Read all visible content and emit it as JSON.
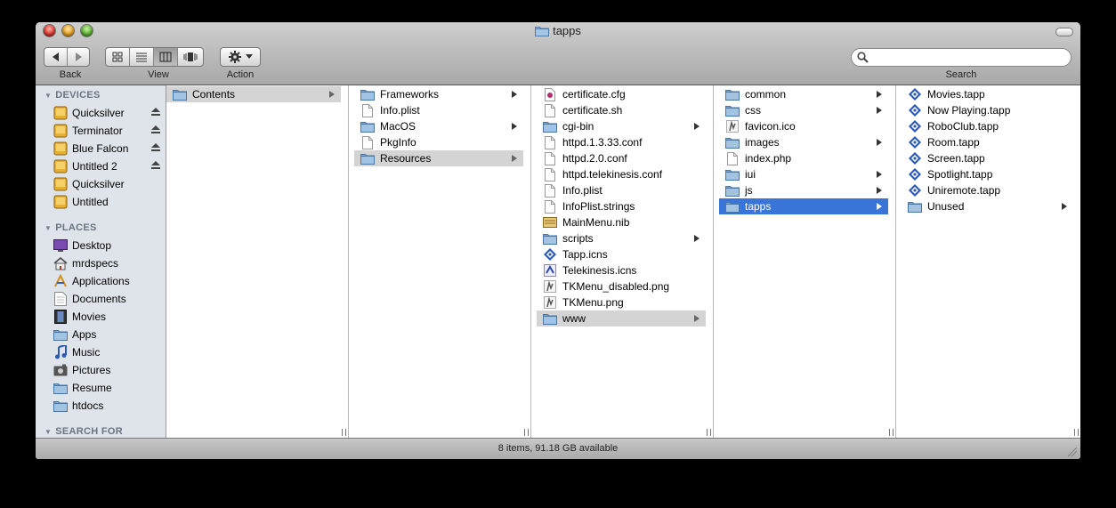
{
  "window": {
    "title": "tapps",
    "status": "8 items, 91.18 GB available"
  },
  "toolbar": {
    "back_label": "Back",
    "view_label": "View",
    "action_label": "Action",
    "search_label": "Search",
    "search_placeholder": ""
  },
  "sidebar": {
    "devices_header": "DEVICES",
    "devices": [
      {
        "label": "Quicksilver",
        "icon": "hd-icon",
        "eject": true
      },
      {
        "label": "Terminator",
        "icon": "hd-icon",
        "eject": true
      },
      {
        "label": "Blue Falcon",
        "icon": "hd-icon",
        "eject": true
      },
      {
        "label": "Untitled 2",
        "icon": "hd-icon",
        "eject": true
      },
      {
        "label": "Quicksilver",
        "icon": "hd-icon",
        "eject": false
      },
      {
        "label": "Untitled",
        "icon": "hd-icon",
        "eject": false
      }
    ],
    "places_header": "PLACES",
    "places": [
      {
        "label": "Desktop",
        "icon": "desktop-icon"
      },
      {
        "label": "mrdspecs",
        "icon": "home-icon"
      },
      {
        "label": "Applications",
        "icon": "applications-icon"
      },
      {
        "label": "Documents",
        "icon": "documents-icon"
      },
      {
        "label": "Movies",
        "icon": "movies-icon"
      },
      {
        "label": "Apps",
        "icon": "folder-icon"
      },
      {
        "label": "Music",
        "icon": "music-icon"
      },
      {
        "label": "Pictures",
        "icon": "pictures-icon"
      },
      {
        "label": "Resume",
        "icon": "folder-icon"
      },
      {
        "label": "htdocs",
        "icon": "folder-icon"
      }
    ],
    "search_header": "SEARCH FOR"
  },
  "columns": [
    {
      "items": [
        {
          "label": "Contents",
          "type": "folder",
          "arrow": true,
          "selected": "gray"
        }
      ]
    },
    {
      "items": [
        {
          "label": "Frameworks",
          "type": "folder",
          "arrow": true
        },
        {
          "label": "Info.plist",
          "type": "file"
        },
        {
          "label": "MacOS",
          "type": "folder",
          "arrow": true
        },
        {
          "label": "PkgInfo",
          "type": "file"
        },
        {
          "label": "Resources",
          "type": "folder",
          "arrow": true,
          "selected": "gray"
        }
      ]
    },
    {
      "items": [
        {
          "label": "certificate.cfg",
          "type": "cfg"
        },
        {
          "label": "certificate.sh",
          "type": "file"
        },
        {
          "label": "cgi-bin",
          "type": "folder",
          "arrow": true
        },
        {
          "label": "httpd.1.3.33.conf",
          "type": "file"
        },
        {
          "label": "httpd.2.0.conf",
          "type": "file"
        },
        {
          "label": "httpd.telekinesis.conf",
          "type": "file"
        },
        {
          "label": "Info.plist",
          "type": "file"
        },
        {
          "label": "InfoPlist.strings",
          "type": "file"
        },
        {
          "label": "MainMenu.nib",
          "type": "nib"
        },
        {
          "label": "scripts",
          "type": "folder",
          "arrow": true
        },
        {
          "label": "Tapp.icns",
          "type": "tapp"
        },
        {
          "label": "Telekinesis.icns",
          "type": "icns"
        },
        {
          "label": "TKMenu_disabled.png",
          "type": "png"
        },
        {
          "label": "TKMenu.png",
          "type": "png"
        },
        {
          "label": "www",
          "type": "folder",
          "arrow": true,
          "selected": "gray"
        }
      ]
    },
    {
      "items": [
        {
          "label": "common",
          "type": "folder",
          "arrow": true
        },
        {
          "label": "css",
          "type": "folder",
          "arrow": true
        },
        {
          "label": "favicon.ico",
          "type": "png"
        },
        {
          "label": "images",
          "type": "folder",
          "arrow": true
        },
        {
          "label": "index.php",
          "type": "file"
        },
        {
          "label": "iui",
          "type": "folder",
          "arrow": true
        },
        {
          "label": "js",
          "type": "folder",
          "arrow": true
        },
        {
          "label": "tapps",
          "type": "folder",
          "arrow": true,
          "selected": "blue"
        }
      ]
    },
    {
      "items": [
        {
          "label": "Movies.tapp",
          "type": "tapp"
        },
        {
          "label": "Now Playing.tapp",
          "type": "tapp"
        },
        {
          "label": "RoboClub.tapp",
          "type": "tapp"
        },
        {
          "label": "Room.tapp",
          "type": "tapp"
        },
        {
          "label": "Screen.tapp",
          "type": "tapp"
        },
        {
          "label": "Spotlight.tapp",
          "type": "tapp"
        },
        {
          "label": "Uniremote.tapp",
          "type": "tapp"
        },
        {
          "label": "Unused",
          "type": "folder",
          "arrow": true
        }
      ]
    }
  ],
  "colors": {
    "selection_blue": "#3875d7",
    "selection_gray": "#d4d4d4",
    "sidebar_bg": "#dee4ea"
  }
}
